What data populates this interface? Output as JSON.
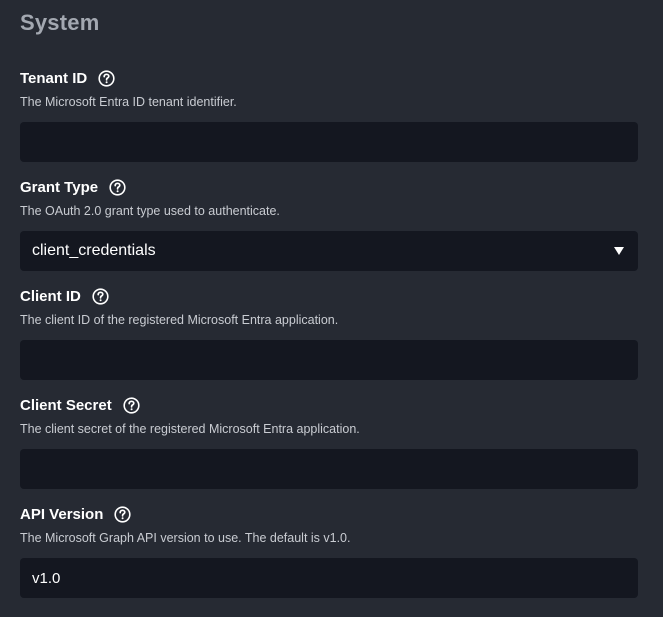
{
  "section": {
    "title": "System"
  },
  "fields": {
    "tenant_id": {
      "label": "Tenant ID",
      "description": "The Microsoft Entra ID tenant identifier.",
      "value": ""
    },
    "grant_type": {
      "label": "Grant Type",
      "description": "The OAuth 2.0 grant type used to authenticate.",
      "value": "client_credentials"
    },
    "client_id": {
      "label": "Client ID",
      "description": "The client ID of the registered Microsoft Entra application.",
      "value": ""
    },
    "client_secret": {
      "label": "Client Secret",
      "description": "The client secret of the registered Microsoft Entra application.",
      "value": ""
    },
    "api_version": {
      "label": "API Version",
      "description": "The Microsoft Graph API version to use. The default is v1.0.",
      "value": "v1.0"
    }
  },
  "icons": {
    "help": "question-circle-icon",
    "caret": "caret-down-icon"
  },
  "colors": {
    "background": "#262a33",
    "input_background": "#141720",
    "section_title": "#a3a8b1",
    "label": "#ffffff",
    "description": "#c9ccd2"
  }
}
